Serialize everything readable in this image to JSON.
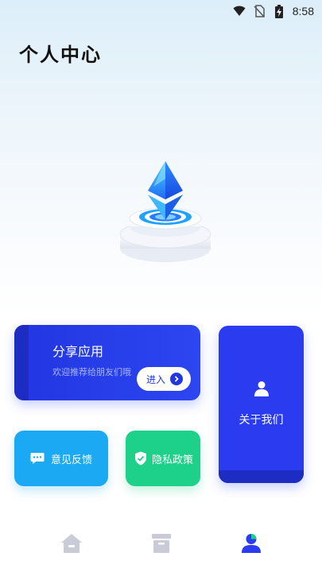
{
  "status_bar": {
    "time": "8:58",
    "icons": [
      "wifi-icon",
      "no-sim-icon",
      "battery-charging-icon"
    ]
  },
  "header": {
    "title": "个人中心"
  },
  "hero": {
    "icon": "ethereum-pedestal-illustration"
  },
  "share_card": {
    "title": "分享应用",
    "subtitle": "欢迎推荐给朋友们哦",
    "button_label": "进入"
  },
  "about_card": {
    "label": "关于我们",
    "icon": "user-icon"
  },
  "feedback_card": {
    "label": "意见反馈",
    "icon": "chat-bubble-icon"
  },
  "privacy_card": {
    "label": "隐私政策",
    "icon": "shield-check-icon"
  },
  "tab_bar": {
    "items": [
      {
        "icon": "home-icon",
        "active": false
      },
      {
        "icon": "archive-box-icon",
        "active": false
      },
      {
        "icon": "profile-icon",
        "active": true
      }
    ]
  },
  "colors": {
    "primary_blue": "#2a3bf0",
    "feedback_blue": "#1aa9f2",
    "privacy_green": "#1ed18b",
    "tab_inactive": "#c9ccd6"
  }
}
